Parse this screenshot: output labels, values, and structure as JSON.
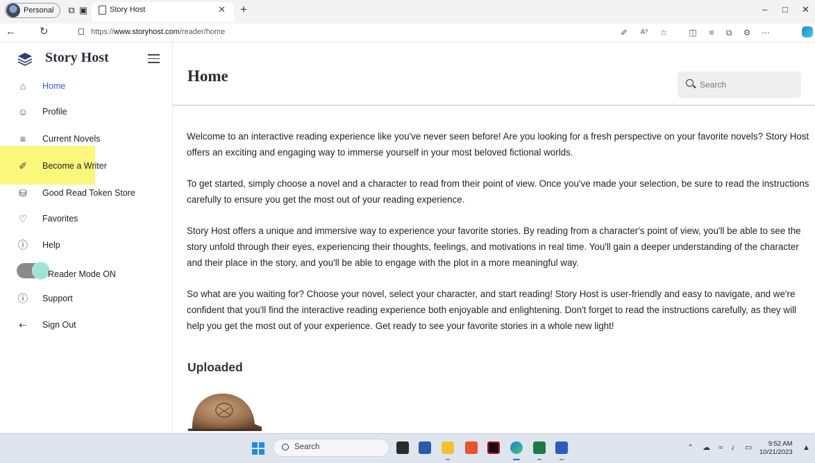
{
  "browser": {
    "profile_label": "Personal",
    "tab_title": "Story Host",
    "url_prefix": "https://",
    "url_domain": "www.storyhost.com",
    "url_path": "/reader/home"
  },
  "sidebar": {
    "brand": "Story Host",
    "items": [
      {
        "label": "Home",
        "icon": "home-icon",
        "active": true
      },
      {
        "label": "Profile",
        "icon": "user-icon"
      },
      {
        "label": "Current Novels",
        "icon": "book-open-icon"
      },
      {
        "label": "Become a Writer",
        "icon": "pencil-icon"
      },
      {
        "label": "Good Read Token Store",
        "icon": "database-icon"
      },
      {
        "label": "Favorites",
        "icon": "heart-icon"
      },
      {
        "label": "Help",
        "icon": "help-icon"
      },
      {
        "label": "Support",
        "icon": "help-icon"
      },
      {
        "label": "Sign Out",
        "icon": "sign-out-icon"
      }
    ],
    "reader_mode_label": "Reader Mode ON",
    "reader_mode_on": true,
    "highlight_color": "#fbf77a"
  },
  "main": {
    "title": "Home",
    "search_placeholder": "Search",
    "paragraphs": [
      "Welcome to an interactive reading experience like you've never seen before! Are you looking for a fresh perspective on your favorite novels? Story Host offers an exciting and engaging way to immerse yourself in your most beloved fictional worlds.",
      "To get started, simply choose a novel and a character to read from their point of view. Once you've made your selection, be sure to read the instructions carefully to ensure you get the most out of your reading experience.",
      "Story Host offers a unique and immersive way to experience your favorite stories. By reading from a character's point of view, you'll be able to see the story unfold through their eyes, experiencing their thoughts, feelings, and motivations in real time. You'll gain a deeper understanding of the character and their place in the story, and you'll be able to engage with the plot in a more meaningful way.",
      "So what are you waiting for? Choose your novel, select your character, and start reading! Story Host is user-friendly and easy to navigate, and we're confident that you'll find the interactive reading experience both enjoyable and enlightening. Don't forget to read the instructions carefully, as they will help you get the most out of your experience. Get ready to see your favorite stories in a whole new light!"
    ],
    "uploaded_title": "Uploaded"
  },
  "taskbar": {
    "search_label": "Search",
    "time": "9:52 AM",
    "date": "10/21/2023"
  },
  "colors": {
    "accent": "#3b5bdb",
    "toggle_track": "#8a8a8a",
    "toggle_knob": "#9fe3d8"
  }
}
